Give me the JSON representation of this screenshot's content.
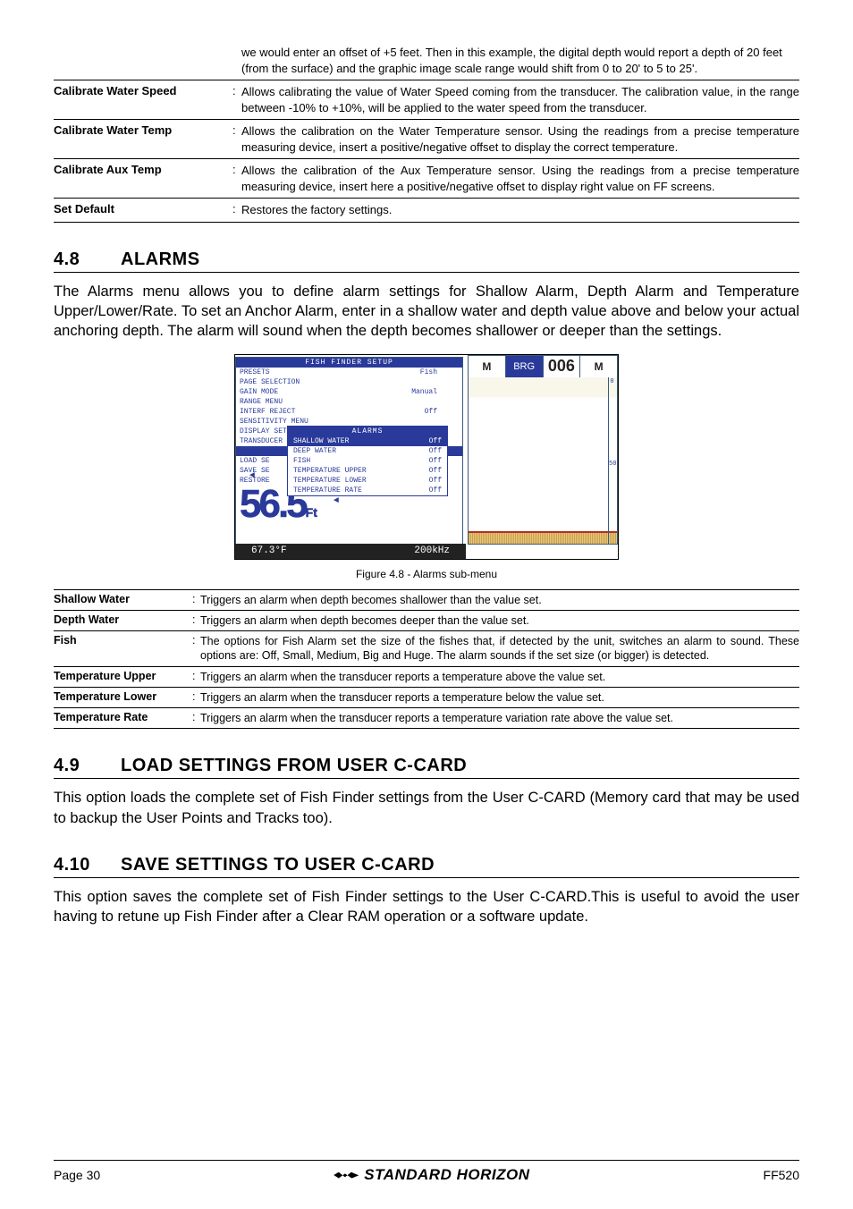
{
  "intro_para": "we would enter an offset of +5 feet. Then in this example, the digital depth would report a depth of 20 feet (from the surface) and the graphic image scale range would shift from 0 to 20' to 5 to 25'.",
  "top_defs": [
    {
      "term": "Calibrate Water Speed",
      "desc": "Allows calibrating the value of Water Speed coming from the transducer. The calibration value, in the range between -10% to +10%, will be applied to the water speed from the transducer."
    },
    {
      "term": "Calibrate Water Temp",
      "desc": "Allows the calibration on the Water Temperature sensor. Using the readings from a precise temperature measuring device, insert a positive/negative offset to display the correct temperature."
    },
    {
      "term": "Calibrate Aux Temp",
      "desc": "Allows the calibration of the Aux Temperature sensor. Using the readings from a precise temperature measuring device, insert here a positive/negative offset to display right value on FF screens."
    },
    {
      "term": "Set Default",
      "desc": "Restores the factory settings."
    }
  ],
  "sec48": {
    "num": "4.8",
    "title": "ALARMS"
  },
  "sec48_body": "The Alarms menu allows you to define alarm settings for Shallow Alarm, Depth Alarm and Temperature Upper/Lower/Rate. To set an Anchor Alarm, enter in a shallow water and depth value above and below your actual anchoring depth. The alarm will sound when the depth becomes shallower or deeper than the settings.",
  "fig": {
    "title_bar": "FISH FINDER SETUP",
    "menu": [
      {
        "l": "PRESETS",
        "r": "Fish"
      },
      {
        "l": "PAGE SELECTION",
        "r": ""
      },
      {
        "l": "GAIN MODE",
        "r": "Manual"
      },
      {
        "l": "RANGE MENU",
        "r": ""
      },
      {
        "l": "INTERF REJECT",
        "r": "Off"
      },
      {
        "l": "SENSITIVITY MENU",
        "r": ""
      },
      {
        "l": "DISPLAY SETUP",
        "r": ""
      },
      {
        "l": "TRANSDUCER SETUP",
        "r": ""
      }
    ],
    "alarms_bar": "ALARMS",
    "left_stubs": [
      "LOAD SE",
      "SAVE SE",
      "RESTORE"
    ],
    "sub_bar": "ALARMS",
    "sub_rows": [
      {
        "l": "SHALLOW WATER",
        "r": "Off",
        "sel": true
      },
      {
        "l": "DEEP WATER",
        "r": "Off"
      },
      {
        "l": "FISH",
        "r": "Off"
      },
      {
        "l": "TEMPERATURE UPPER",
        "r": "Off"
      },
      {
        "l": "TEMPERATURE LOWER",
        "r": "Off"
      },
      {
        "l": "TEMPERATURE RATE",
        "r": "Off"
      }
    ],
    "big_depth": "56.5",
    "big_unit": "Ft",
    "temp": "67.3°F",
    "freq": "200kHz",
    "right_top": {
      "m1": "M",
      "brg": "BRG",
      "val": "006",
      "m2": "M"
    },
    "scale": [
      "0",
      "",
      "50",
      "",
      ""
    ]
  },
  "fig_caption": "Figure 4.8 -  Alarms sub-menu",
  "alarm_defs": [
    {
      "term": "Shallow Water",
      "desc": "Triggers an alarm when depth becomes shallower than the value set."
    },
    {
      "term": "Depth Water",
      "desc": "Triggers an alarm when depth becomes deeper than the value set."
    },
    {
      "term": "Fish",
      "desc": "The options for Fish Alarm set the size of the fishes that, if detected by the unit, switches an alarm to sound. These options are: Off, Small, Medium, Big and Huge. The alarm sounds if the set size (or bigger) is detected."
    },
    {
      "term": "Temperature Upper",
      "desc": "Triggers an alarm when the transducer reports a temperature above the value set."
    },
    {
      "term": "Temperature Lower",
      "desc": "Triggers an alarm when the transducer reports a temperature below the value set."
    },
    {
      "term": "Temperature Rate",
      "desc": "Triggers an alarm when the transducer reports a temperature variation rate above the value set."
    }
  ],
  "sec49": {
    "num": "4.9",
    "title": "LOAD SETTINGS FROM USER C-CARD"
  },
  "sec49_body": "This option loads the complete set of Fish Finder settings from the User C-CARD (Memory card that may be used to backup the User Points and Tracks too).",
  "sec410": {
    "num": "4.10",
    "title": "SAVE SETTINGS TO USER C-CARD"
  },
  "sec410_body": "This option saves the complete set of Fish Finder settings to the User C-CARD.This is useful to avoid the user having to retune up Fish Finder after a Clear RAM operation or a software update.",
  "footer": {
    "page": "Page  30",
    "brand": "STANDARD HORIZON",
    "model": "FF520"
  }
}
